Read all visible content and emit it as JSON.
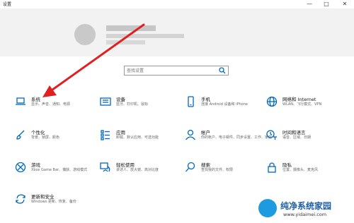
{
  "window": {
    "title": "设置",
    "minimize": "—",
    "maximize": "□",
    "close": "✕"
  },
  "search": {
    "placeholder": "查找设置"
  },
  "tiles": [
    {
      "id": "system",
      "title": "系统",
      "desc": "显示、声音、通知、电源",
      "icon": "laptop-icon"
    },
    {
      "id": "devices",
      "title": "设备",
      "desc": "蓝牙、打印机、鼠标",
      "icon": "keyboard-icon"
    },
    {
      "id": "phone",
      "title": "手机",
      "desc": "连接 Android 设备和 iPhone",
      "icon": "phone-icon"
    },
    {
      "id": "network",
      "title": "网络和 Internet",
      "desc": "WLAN、飞行模式、VPN",
      "icon": "globe-icon"
    },
    {
      "id": "personalization",
      "title": "个性化",
      "desc": "背景、锁屏、颜色",
      "icon": "paintbrush-icon"
    },
    {
      "id": "apps",
      "title": "应用",
      "desc": "卸载、默认应用、可选功能",
      "icon": "apps-list-icon"
    },
    {
      "id": "accounts",
      "title": "帐户",
      "desc": "你的帐户、电子邮件、同步设置、工作、家庭",
      "icon": "person-icon"
    },
    {
      "id": "time-language",
      "title": "时间和语言",
      "desc": "语音、区域、日期",
      "icon": "time-language-icon"
    },
    {
      "id": "gaming",
      "title": "游戏",
      "desc": "Xbox Game Bar、捕获、游戏模式",
      "icon": "xbox-icon"
    },
    {
      "id": "ease",
      "title": "轻松使用",
      "desc": "讲述人、放大镜、高对比度",
      "icon": "ease-of-access-icon"
    },
    {
      "id": "search",
      "title": "搜索",
      "desc": "查找我的文件、权限",
      "icon": "magnifier-icon"
    },
    {
      "id": "privacy",
      "title": "隐私",
      "desc": "位置、摄像头、麦克风",
      "icon": "lock-icon"
    },
    {
      "id": "update",
      "title": "更新和安全",
      "desc": "Windows 更新、恢复、备份",
      "icon": "sync-icon"
    }
  ],
  "watermark": {
    "text": "纯净系统家园",
    "url": "www.yidaimei.com"
  },
  "colors": {
    "accent": "#0067c0",
    "arrow": "#e02020",
    "header_bg": "#f2f2f2"
  }
}
